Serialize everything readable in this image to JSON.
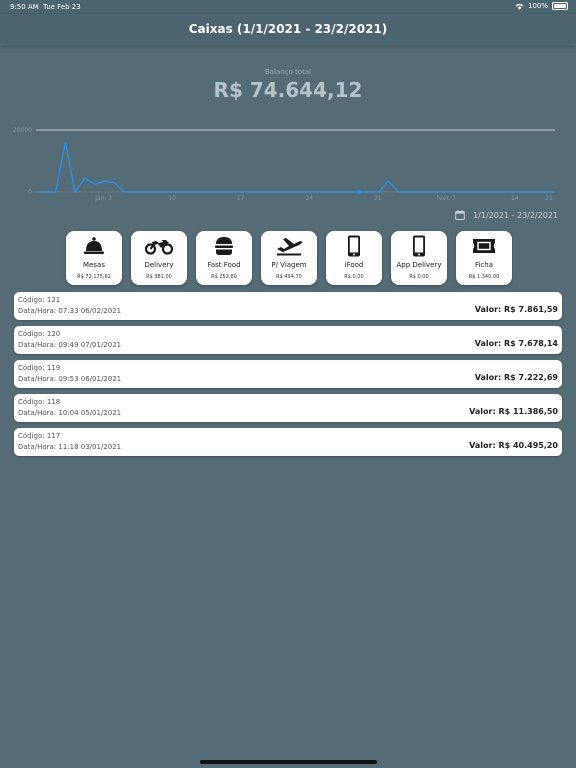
{
  "status_bar": {
    "time": "9:50 AM",
    "date": "Tue Feb 23",
    "battery": "100%"
  },
  "header": {
    "title": "Caixas (1/1/2021 - 23/2/2021)"
  },
  "balance": {
    "label": "Balanço total",
    "value": "R$ 74.644,12"
  },
  "chart_data": {
    "type": "line",
    "ytick_labels": [
      "0",
      "20000"
    ],
    "xtick_labels": [
      "jan. 3",
      "10",
      "17",
      "24",
      "31",
      "fevr. 7",
      "14",
      "21"
    ],
    "ylim": [
      0,
      20000
    ],
    "series": [
      {
        "color": "#2f8fe0",
        "x": [
          "2021-01-01",
          "2021-01-03",
          "2021-01-04",
          "2021-01-05",
          "2021-01-06",
          "2021-01-07",
          "2021-01-08",
          "2021-01-09",
          "2021-01-10",
          "2021-01-12",
          "2021-01-14",
          "2021-01-17",
          "2021-01-20",
          "2021-01-24",
          "2021-01-28",
          "2021-01-31",
          "2021-02-03",
          "2021-02-05",
          "2021-02-06",
          "2021-02-07",
          "2021-02-10",
          "2021-02-14",
          "2021-02-18",
          "2021-02-21",
          "2021-02-23"
        ],
        "values": [
          0,
          0,
          16000,
          0,
          4500,
          2500,
          3500,
          3000,
          0,
          0,
          0,
          0,
          0,
          0,
          0,
          0,
          0,
          0,
          3500,
          0,
          0,
          0,
          0,
          0,
          0
        ]
      }
    ],
    "grid": false
  },
  "date_filter": {
    "label": "1/1/2021 - 23/2/2021",
    "icon": "calendar-icon"
  },
  "categories": [
    {
      "name": "mesas",
      "icon": "bell-icon",
      "label": "Mesas",
      "amount": "R$ 72.175,62"
    },
    {
      "name": "delivery",
      "icon": "motorcycle-icon",
      "label": "Delivery",
      "amount": "R$ 381,00"
    },
    {
      "name": "fast-food",
      "icon": "burger-icon",
      "label": "Fast Food",
      "amount": "R$ 252,80"
    },
    {
      "name": "p-viagem",
      "icon": "plane-icon",
      "label": "P/ Viagem",
      "amount": "R$ 494,70"
    },
    {
      "name": "ifood",
      "icon": "phone-icon",
      "label": "iFood",
      "amount": "R$ 0,00"
    },
    {
      "name": "app-delivery",
      "icon": "phone-icon",
      "label": "App Delivery",
      "amount": "R$ 0,00"
    },
    {
      "name": "ficha",
      "icon": "ticket-icon",
      "label": "Ficha",
      "amount": "R$ 1.340,00"
    }
  ],
  "caixas": [
    {
      "code": "Código: 121",
      "datetime": "Data/Hora: 07:33 06/02/2021",
      "value": "Valor: R$ 7.861,59"
    },
    {
      "code": "Código: 120",
      "datetime": "Data/Hora: 09:49 07/01/2021",
      "value": "Valor: R$ 7.678,14"
    },
    {
      "code": "Código: 119",
      "datetime": "Data/Hora: 09:53 06/01/2021",
      "value": "Valor: R$ 7.222,69"
    },
    {
      "code": "Código: 118",
      "datetime": "Data/Hora: 10:04 05/01/2021",
      "value": "Valor: R$ 11.386,50"
    },
    {
      "code": "Código: 117",
      "datetime": "Data/Hora: 11:18 03/01/2021",
      "value": "Valor: R$ 40.495,20"
    }
  ]
}
